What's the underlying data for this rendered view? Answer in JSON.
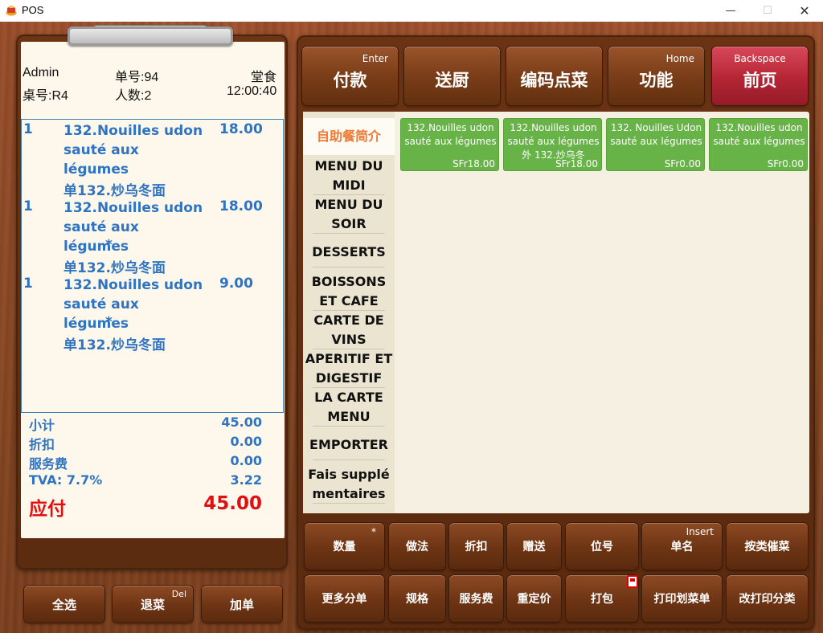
{
  "window": {
    "title": "POS",
    "min": "—",
    "max": "☐",
    "close": "✕"
  },
  "order": {
    "user": "Admin",
    "order_no": "单号:94",
    "dine_type": "堂食",
    "table": "桌号:R4",
    "guests": "人数:2",
    "time": "12:00:40",
    "items": [
      {
        "qty": "1",
        "name": "132.Nouilles udon sauté aux légumes",
        "price": "18.00",
        "star": "",
        "sub": "单132.炒乌冬面"
      },
      {
        "qty": "1",
        "name": "132.Nouilles udon sauté aux légumes",
        "price": "18.00",
        "star": "*",
        "sub": "单132.炒乌冬面"
      },
      {
        "qty": "1",
        "name": "132.Nouilles udon sauté aux légumes",
        "price": "9.00",
        "star": "*",
        "sub": "单132.炒乌冬面"
      }
    ]
  },
  "totals": {
    "subtotal_label": "小计",
    "subtotal": "45.00",
    "discount_label": "折扣",
    "discount": "0.00",
    "service_label": "服务费",
    "service": "0.00",
    "tva_label": "TVA: 7.7%",
    "tva": "3.22",
    "due_label": "应付",
    "due": "45.00"
  },
  "left_buttons": {
    "select_all": "全选",
    "return": "退菜",
    "return_hint": "Del",
    "add": "加单"
  },
  "top_buttons": [
    {
      "label": "付款",
      "hint": "Enter"
    },
    {
      "label": "送厨",
      "hint": ""
    },
    {
      "label": "编码点菜",
      "hint": ""
    },
    {
      "label": "功能",
      "hint": "Home"
    },
    {
      "label": "前页",
      "hint": "Backspace"
    }
  ],
  "categories": [
    "自助餐简介",
    "MENU DU MIDI",
    "MENU DU SOIR",
    "DESSERTS",
    "BOISSONS ET CAFE",
    "CARTE DE VINS",
    "APERITIF ET DIGESTIF",
    "LA CARTE MENU",
    "EMPORTER",
    "Fais supplé mentaires"
  ],
  "dishes": [
    {
      "name": "132.Nouilles udon sauté aux légumes",
      "price": "SFr18.00"
    },
    {
      "name": "132.Nouilles udon sauté aux légumes 外 132.炒乌冬",
      "price": "SFr18.00"
    },
    {
      "name": "132. Nouilles Udon sauté aux légumes",
      "price": "SFr0.00"
    },
    {
      "name": "132.Nouilles udon sauté aux légumes",
      "price": "SFr0.00"
    }
  ],
  "bottom_buttons": {
    "row1": [
      {
        "label": "数量",
        "hint": "*"
      },
      {
        "label": "做法",
        "hint": ""
      },
      {
        "label": "折扣",
        "hint": ""
      },
      {
        "label": "赠送",
        "hint": ""
      },
      {
        "label": "位号",
        "hint": ""
      },
      {
        "label": "单名",
        "hint": "Insert"
      },
      {
        "label": "按类催菜",
        "hint": ""
      }
    ],
    "row2": [
      {
        "label": "更多分单",
        "hint": ""
      },
      {
        "label": "规格",
        "hint": ""
      },
      {
        "label": "服务费",
        "hint": ""
      },
      {
        "label": "重定价",
        "hint": ""
      },
      {
        "label": "打包",
        "hint": ""
      },
      {
        "label": "打印划菜单",
        "hint": ""
      },
      {
        "label": "改打印分类",
        "hint": ""
      }
    ]
  }
}
